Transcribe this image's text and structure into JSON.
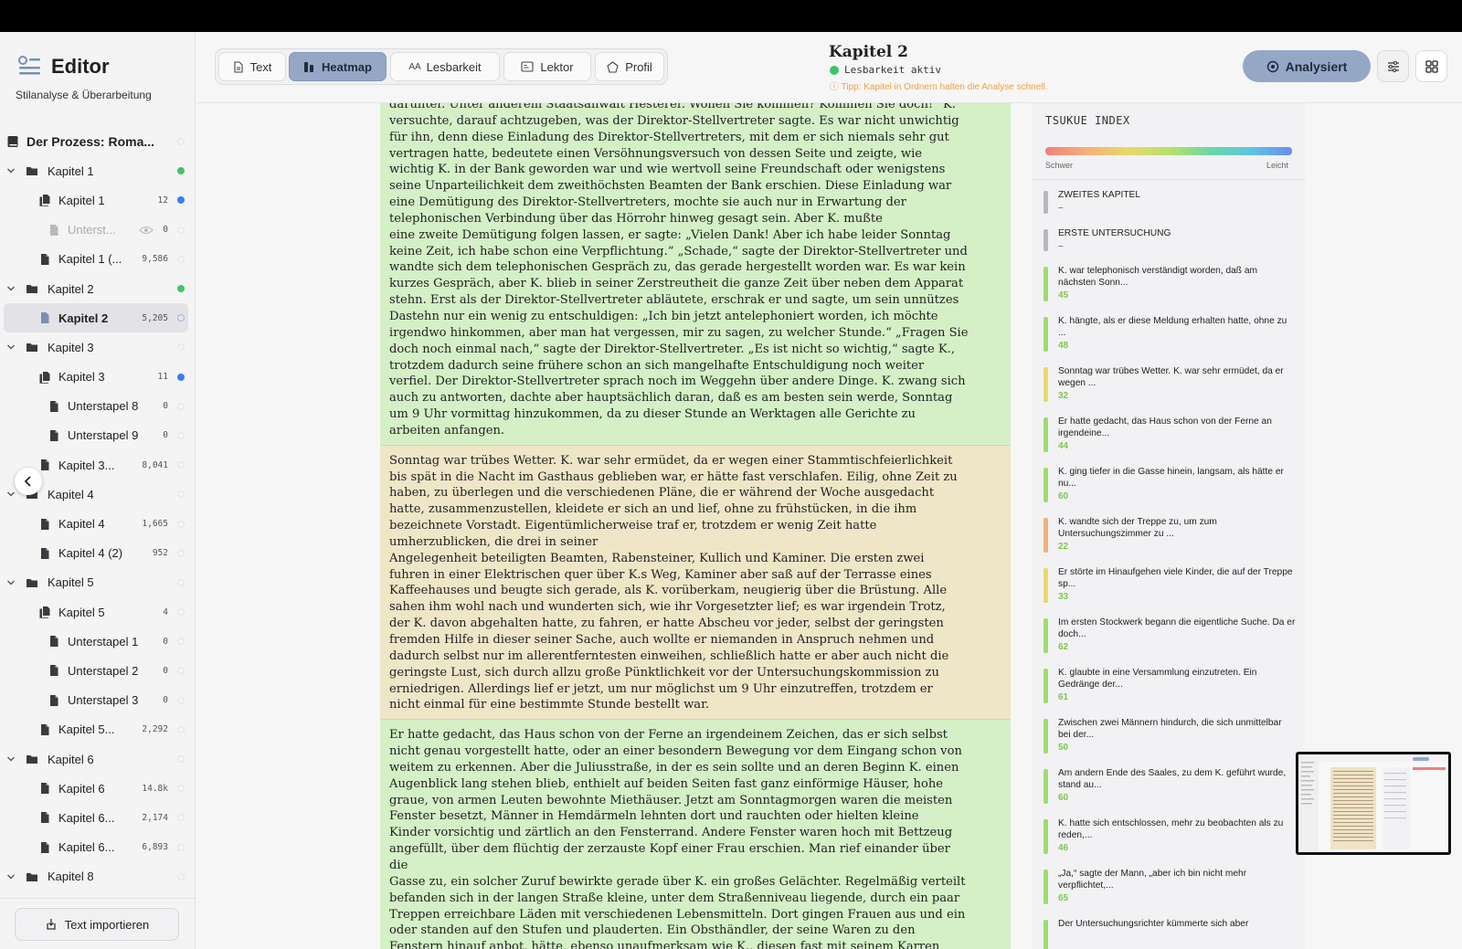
{
  "app": {
    "title": "Editor",
    "subtitle": "Stilanalyse & Überarbeitung"
  },
  "tree": {
    "book": "Der Prozess: Roma...",
    "items": [
      {
        "type": "folder",
        "label": "Kapitel 1",
        "count": "",
        "dot": "green"
      },
      {
        "type": "l1",
        "label": "Kapitel 1",
        "count": "12",
        "dot": "blue",
        "icon": "stack"
      },
      {
        "type": "l2dim",
        "label": "Unterst...",
        "count": "0",
        "dot": "",
        "icon": "doc"
      },
      {
        "type": "l1",
        "label": "Kapitel 1 (...",
        "count": "9,586",
        "dot": "",
        "icon": "doc"
      },
      {
        "type": "folder",
        "label": "Kapitel 2",
        "count": "",
        "dot": "green"
      },
      {
        "type": "sel",
        "label": "Kapitel 2",
        "count": "5,205",
        "dot": "gear",
        "icon": "doc"
      },
      {
        "type": "folder",
        "label": "Kapitel 3",
        "count": "",
        "dot": ""
      },
      {
        "type": "l1",
        "label": "Kapitel 3",
        "count": "11",
        "dot": "blue",
        "icon": "stack"
      },
      {
        "type": "l2",
        "label": "Unterstapel 8",
        "count": "0",
        "dot": "",
        "icon": "doc"
      },
      {
        "type": "l2",
        "label": "Unterstapel 9",
        "count": "0",
        "dot": "",
        "icon": "doc"
      },
      {
        "type": "l1",
        "label": "Kapitel 3...",
        "count": "8,041",
        "dot": "",
        "icon": "doc"
      },
      {
        "type": "folder",
        "label": "Kapitel 4",
        "count": "",
        "dot": ""
      },
      {
        "type": "l1",
        "label": "Kapitel 4",
        "count": "1,665",
        "dot": "",
        "icon": "doc"
      },
      {
        "type": "l1",
        "label": "Kapitel 4 (2)",
        "count": "952",
        "dot": "",
        "icon": "doc"
      },
      {
        "type": "folder",
        "label": "Kapitel 5",
        "count": "",
        "dot": ""
      },
      {
        "type": "l1",
        "label": "Kapitel 5",
        "count": "4",
        "dot": "",
        "icon": "stack"
      },
      {
        "type": "l2",
        "label": "Unterstapel 1",
        "count": "0",
        "dot": "",
        "icon": "doc"
      },
      {
        "type": "l2",
        "label": "Unterstapel 2",
        "count": "0",
        "dot": "",
        "icon": "doc"
      },
      {
        "type": "l2",
        "label": "Unterstapel 3",
        "count": "0",
        "dot": "",
        "icon": "doc"
      },
      {
        "type": "l1",
        "label": "Kapitel 5...",
        "count": "2,292",
        "dot": "",
        "icon": "doc"
      },
      {
        "type": "folder",
        "label": "Kapitel 6",
        "count": "",
        "dot": ""
      },
      {
        "type": "l1",
        "label": "Kapitel 6",
        "count": "14.8k",
        "dot": "",
        "icon": "doc"
      },
      {
        "type": "l1",
        "label": "Kapitel 6...",
        "count": "2,174",
        "dot": "",
        "icon": "doc"
      },
      {
        "type": "l1",
        "label": "Kapitel 6...",
        "count": "6,893",
        "dot": "",
        "icon": "doc"
      },
      {
        "type": "folder",
        "label": "Kapitel 8",
        "count": "",
        "dot": ""
      }
    ]
  },
  "import_label": "Text importieren",
  "tabs": [
    "Text",
    "Heatmap",
    "Lesbarkeit",
    "Lektor",
    "Profil"
  ],
  "active_tab": "Heatmap",
  "document": {
    "title": "Kapitel 2",
    "status": "Lesbarkeit aktiv",
    "tip": "Tipp: Kapitel in Ordnern halten die Analyse schnell."
  },
  "analysed_label": "Analysiert",
  "paragraphs": [
    {
      "tone": "green",
      "text": "darunter. Unter anderem Staatsanwalt Hesterer. Wollen Sie kommen? Kommen Sie doch!“ K.\nversuchte, darauf achtzugeben, was der Direktor-Stellvertreter sagte. Es war nicht unwichtig\nfür ihn, denn diese Einladung des Direktor-Stellvertreters, mit dem er sich niemals sehr gut\nvertragen hatte, bedeutete einen Versöhnungsversuch von dessen Seite und zeigte, wie\nwichtig K. in der Bank geworden war und wie wertvoll seine Freundschaft oder wenigstens\nseine Unparteilichkeit dem zweithöchsten Beamten der Bank erschien. Diese Einladung war\neine Demütigung des Direktor-Stellvertreters, mochte sie auch nur in Erwartung der\ntelephonischen Verbindung über das Hörrohr hinweg gesagt sein. Aber K. mußte\neine zweite Demütigung folgen lassen, er sagte: „Vielen Dank! Aber ich habe leider Sonntag\nkeine Zeit, ich habe schon eine Verpflichtung.“ „Schade,“ sagte der Direktor-Stellvertreter und\nwandte sich dem telephonischen Gespräch zu, das gerade hergestellt worden war. Es war kein\nkurzes Gespräch, aber K. blieb in seiner Zerstreutheit die ganze Zeit über neben dem Apparat\nstehn. Erst als der Direktor-Stellvertreter abläutete, erschrak er und sagte, um sein unnützes\nDastehn nur ein wenig zu entschuldigen: „Ich bin jetzt antelephoniert worden, ich möchte\nirgendwo hinkommen, aber man hat vergessen, mir zu sagen, zu welcher Stunde.“ „Fragen Sie\ndoch noch einmal nach,“ sagte der Direktor-Stellvertreter. „Es ist nicht so wichtig,“ sagte K.,\ntrotzdem dadurch seine frühere schon an sich mangelhafte Entschuldigung noch weiter\nverfiel. Der Direktor-Stellvertreter sprach noch im Weggehn über andere Dinge. K. zwang sich\nauch zu antworten, dachte aber hauptsächlich daran, daß es am besten sein werde, Sonntag\num 9 Uhr vormittag hinzukommen, da zu dieser Stunde an Werktagen alle Gerichte zu\narbeiten anfangen."
    },
    {
      "tone": "tan",
      "text": "Sonntag war trübes Wetter. K. war sehr ermüdet, da er wegen einer Stammtischfeierlichkeit\nbis spät in die Nacht im Gasthaus geblieben war, er hätte fast verschlafen. Eilig, ohne Zeit zu\nhaben, zu überlegen und die verschiedenen Pläne, die er während der Woche ausgedacht\nhatte, zusammenzustellen, kleidete er sich an und lief, ohne zu frühstücken, in die ihm\nbezeichnete Vorstadt. Eigentümlicherweise traf er, trotzdem er wenig Zeit hatte\numherzublicken, die drei in seiner\nAngelegenheit beteiligten Beamten, Rabensteiner, Kullich und Kaminer. Die ersten zwei\nfuhren in einer Elektrischen quer über K.s Weg, Kaminer aber saß auf der Terrasse eines\nKaffeehauses und beugte sich gerade, als K. vorüberkam, neugierig über die Brüstung. Alle\nsahen ihm wohl nach und wunderten sich, wie ihr Vorgesetzter lief; es war irgendein Trotz,\nder K. davon abgehalten hatte, zu fahren, er hatte Abscheu vor jeder, selbst der geringsten\nfremden Hilfe in dieser seiner Sache, auch wollte er niemanden in Anspruch nehmen und\ndadurch selbst nur im allerentferntesten einweihen, schließlich hatte er aber auch nicht die\ngeringste Lust, sich durch allzu große Pünktlichkeit vor der Untersuchungskommission zu\nerniedrigen. Allerdings lief er jetzt, um nur möglichst um 9 Uhr einzutreffen, trotzdem er\nnicht einmal für eine bestimmte Stunde bestellt war."
    },
    {
      "tone": "green",
      "text": "Er hatte gedacht, das Haus schon von der Ferne an irgendeinem Zeichen, das er sich selbst\nnicht genau vorgestellt hatte, oder an einer besondern Bewegung vor dem Eingang schon von\nweitem zu erkennen. Aber die Juliusstraße, in der es sein sollte und an deren Beginn K. einen\nAugenblick lang stehen blieb, enthielt auf beiden Seiten fast ganz einförmige Häuser, hohe\ngraue, von armen Leuten bewohnte Miethäuser. Jetzt am Sonntagmorgen waren die meisten\nFenster besetzt, Männer in Hemdärmeln lehnten dort und rauchten oder hielten kleine\nKinder vorsichtig und zärtlich an den Fensterrand. Andere Fenster waren hoch mit Bettzeug\nangefüllt, über dem flüchtig der zerzauste Kopf einer Frau erschien. Man rief einander über\ndie\nGasse zu, ein solcher Zuruf bewirkte gerade über K. ein großes Gelächter. Regelmäßig verteilt\nbefanden sich in der langen Straße kleine, unter dem Straßenniveau liegende, durch ein paar\nTreppen erreichbare Läden mit verschiedenen Lebensmitteln. Dort gingen Frauen aus und ein\noder standen auf den Stufen und plauderten. Ein Obsthändler, der seine Waren zu den\nFenstern hinauf anbot, hätte, ebenso unaufmerksam wie K., diesen fast mit seinem Karren"
    }
  ],
  "index_panel": {
    "title": "TSUKUE INDEX",
    "scale_left": "Schwer",
    "scale_right": "Leicht",
    "items": [
      {
        "text": "ZWEITES KAPITEL",
        "value": "–",
        "color": "#b8b8bc"
      },
      {
        "text": "ERSTE UNTERSUCHUNG",
        "value": "–",
        "color": "#b8b8bc"
      },
      {
        "text": "K. war telephonisch verständigt worden, daß am nächsten Sonn...",
        "value": "45",
        "color": "#9fdc6e"
      },
      {
        "text": "K. hängte, als er diese Meldung erhalten hatte, ohne zu ...",
        "value": "48",
        "color": "#9fdc6e"
      },
      {
        "text": "Sonntag war trübes Wetter. K. war sehr ermüdet, da er wegen ...",
        "value": "32",
        "color": "#e9d86a"
      },
      {
        "text": "Er hatte gedacht, das Haus schon von der Ferne an irgendeine...",
        "value": "44",
        "color": "#9fdc6e"
      },
      {
        "text": "K. ging tiefer in die Gasse hinein, langsam, als hätte er nu...",
        "value": "60",
        "color": "#9fdc6e"
      },
      {
        "text": "K. wandte sich der Treppe zu, um zum Untersuchungszimmer zu ...",
        "value": "22",
        "color": "#f3b07a"
      },
      {
        "text": "Er störte im Hinaufgehen viele Kinder, die auf der Treppe sp...",
        "value": "33",
        "color": "#e9d86a"
      },
      {
        "text": "Im ersten Stockwerk begann die eigentliche Suche. Da er doch...",
        "value": "62",
        "color": "#9fdc6e"
      },
      {
        "text": "K. glaubte in eine Versammlung einzutreten. Ein Gedränge der...",
        "value": "61",
        "color": "#9fdc6e"
      },
      {
        "text": "Zwischen zwei Männern hindurch, die sich unmittelbar bei der...",
        "value": "50",
        "color": "#9fdc6e"
      },
      {
        "text": "Am andern Ende des Saales, zu dem K. geführt wurde, stand au...",
        "value": "60",
        "color": "#9fdc6e"
      },
      {
        "text": "K. hatte sich entschlossen, mehr zu beobachten als zu reden,...",
        "value": "46",
        "color": "#9fdc6e"
      },
      {
        "text": "„Ja,“ sagte der Mann, „aber ich bin nicht mehr verpflichtet,...",
        "value": "65",
        "color": "#9fdc6e"
      },
      {
        "text": "Der Untersuchungsrichter kümmerte sich aber",
        "value": "",
        "color": "#9fdc6e"
      }
    ]
  }
}
